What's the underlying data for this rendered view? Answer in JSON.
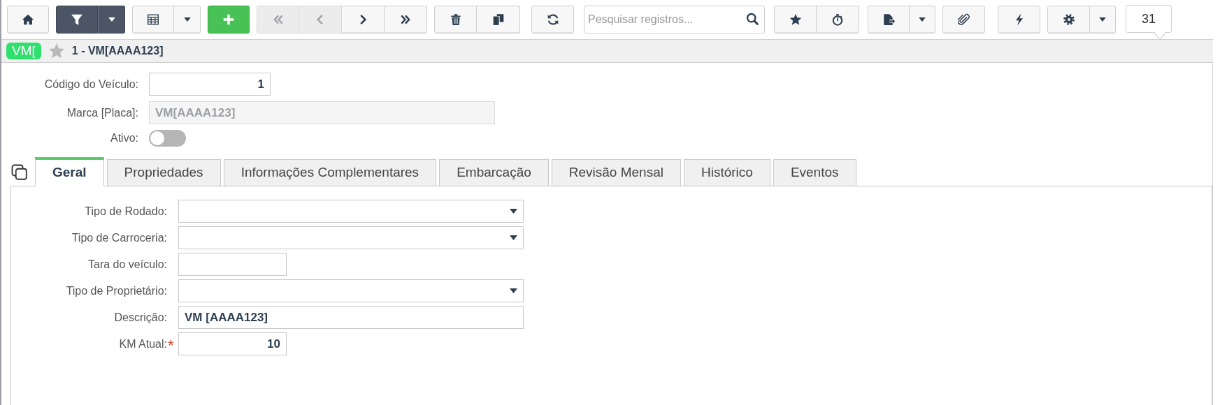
{
  "toolbar": {
    "filter_active": true,
    "navigation": [
      {
        "disabled": true
      },
      {
        "disabled": true
      },
      {
        "disabled": false
      },
      {
        "disabled": false
      }
    ],
    "search": {
      "placeholder": "Pesquisar registros..."
    },
    "counter": "31"
  },
  "header": {
    "badge": "VM[",
    "favorite": false,
    "title": "1 - VM[AAAA123]"
  },
  "record": {
    "code": {
      "label": "Código do Veículo:",
      "value": "1"
    },
    "brand": {
      "label": "Marca [Placa]:",
      "value": "VM[AAAA123]",
      "disabled": true
    },
    "active": {
      "label": "Ativo:",
      "on": false
    }
  },
  "tabs": [
    {
      "label": "Geral",
      "selected": true
    },
    {
      "label": "Propriedades",
      "selected": false
    },
    {
      "label": "Informações Complementares",
      "selected": false
    },
    {
      "label": "Embarcação",
      "selected": false
    },
    {
      "label": "Revisão Mensal",
      "selected": false
    },
    {
      "label": "Histórico",
      "selected": false
    },
    {
      "label": "Eventos",
      "selected": false
    }
  ],
  "fields": [
    {
      "kind": "select",
      "label": "Tipo de Rodado:",
      "required": false
    },
    {
      "kind": "select",
      "label": "Tipo de Carroceria:",
      "required": false
    },
    {
      "kind": "number",
      "label": "Tara do veículo:",
      "required": false
    },
    {
      "kind": "select",
      "label": "Tipo de Proprietário:",
      "required": false
    },
    {
      "kind": "text",
      "label": "Descrição:",
      "value": "VM [AAAA123]",
      "required": false
    },
    {
      "kind": "number",
      "label": "KM Atual:",
      "value": "10",
      "required": true
    }
  ],
  "required_mark": "*"
}
